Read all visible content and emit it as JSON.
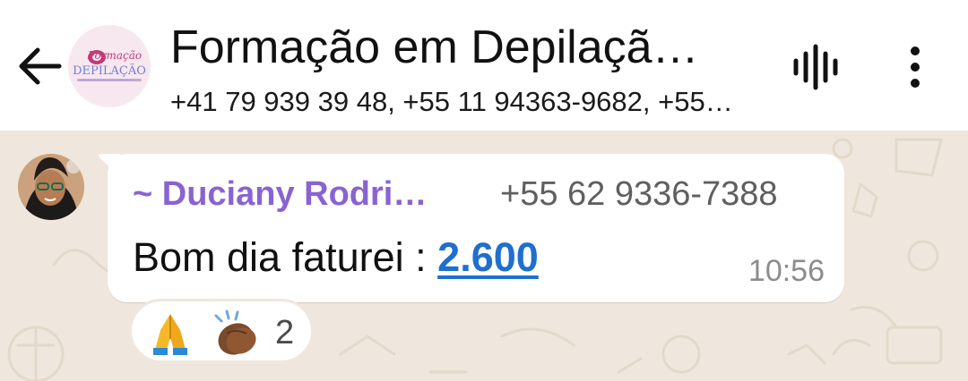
{
  "header": {
    "title": "Formação em Depilaçã…",
    "subtitle": "+41 79 939 39 48, +55 11 94363-9682, +55…",
    "avatar_logo_line1": "Formação",
    "avatar_logo_line2": "DEPILAÇÃO",
    "back_icon": "arrow-left-icon",
    "voice_icon": "voice-waveform-icon",
    "menu_icon": "more-vertical-icon"
  },
  "message": {
    "sender_name": "~ Duciany Rodri…",
    "sender_phone": "+55 62 9336-7388",
    "text_prefix": "Bom dia faturei : ",
    "text_link": "2.600",
    "time": "10:56"
  },
  "reactions": {
    "emojis": [
      "folded-hands",
      "clapping-hands"
    ],
    "count": "2"
  },
  "colors": {
    "header_bg": "#ffffff",
    "chat_bg": "#efe7dd",
    "sender_name": "#8a63d2",
    "link": "#1f6fcf",
    "timestamp": "#8c8c8c"
  }
}
